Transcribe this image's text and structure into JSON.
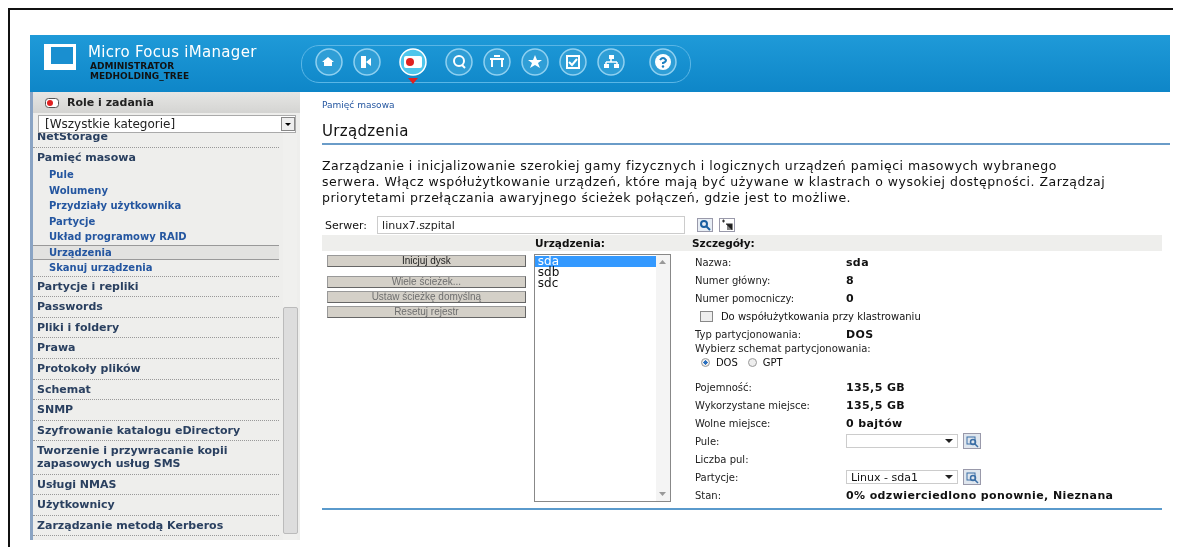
{
  "header": {
    "title": "Micro Focus iManager",
    "user": "ADMINISTRATOR",
    "tree": "MEDHOLDING_TREE",
    "toolbar": [
      {
        "kind": "home",
        "selected": false
      },
      {
        "kind": "exit",
        "selected": false
      },
      {
        "kind": "roles",
        "selected": true
      },
      {
        "kind": "view",
        "selected": false
      },
      {
        "kind": "desk",
        "selected": false
      },
      {
        "kind": "star",
        "selected": false
      },
      {
        "kind": "tasks",
        "selected": false
      },
      {
        "kind": "tree",
        "selected": false
      },
      {
        "kind": "help",
        "selected": false
      }
    ]
  },
  "sidebar": {
    "heading": "Role i zadania",
    "category": "[Wszystkie kategorie]",
    "items": [
      {
        "label": "NetStorage"
      },
      {
        "label": "Pamięć masowa",
        "children": [
          {
            "label": "Pule",
            "selected": false
          },
          {
            "label": "Wolumeny",
            "selected": false
          },
          {
            "label": "Przydziały użytkownika",
            "selected": false
          },
          {
            "label": "Partycje",
            "selected": false
          },
          {
            "label": "Układ programowy RAID",
            "selected": false
          },
          {
            "label": "Urządzenia",
            "selected": true
          },
          {
            "label": "Skanuj urządzenia",
            "selected": false
          }
        ]
      },
      {
        "label": "Partycje i repliki"
      },
      {
        "label": "Passwords"
      },
      {
        "label": "Pliki i foldery"
      },
      {
        "label": "Prawa"
      },
      {
        "label": "Protokoły plików"
      },
      {
        "label": "Schemat"
      },
      {
        "label": "SNMP"
      },
      {
        "label": "Szyfrowanie katalogu eDirectory"
      },
      {
        "label": "Tworzenie i przywracanie kopii zapasowych usług SMS"
      },
      {
        "label": "Usługi NMAS"
      },
      {
        "label": "Użytkownicy"
      },
      {
        "label": "Zarządzanie metodą Kerberos"
      }
    ]
  },
  "content": {
    "breadcrumb": "Pamięć masowa",
    "title": "Urządzenia",
    "description": "Zarządzanie i inicjalizowanie szerokiej gamy fizycznych i logicznych urządzeń pamięci masowych wybranego serwera. Włącz współużytkowanie urządzeń, które mają być używane w klastrach o wysokiej dostępności. Zarządzaj priorytetami przełączania awaryjnego ścieżek połączeń, gdzie jest to możliwe.",
    "server": {
      "label": "Serwer:",
      "value": "linux7.szpital"
    },
    "devices_header": "Urządzenia:",
    "details_header": "Szczegóły:",
    "buttons": [
      {
        "label": "Inicjuj dysk",
        "disabled": false
      },
      {
        "label": "Wiele ścieżek...",
        "disabled": true
      },
      {
        "label": "Ustaw ścieżkę domyślną",
        "disabled": true
      },
      {
        "label": "Resetuj rejestr",
        "disabled": true
      }
    ],
    "devices": [
      {
        "name": "sda",
        "selected": true
      },
      {
        "name": "sdb",
        "selected": false
      },
      {
        "name": "sdc",
        "selected": false
      }
    ],
    "details": [
      {
        "kind": "text",
        "label": "Nazwa:",
        "value": "sda"
      },
      {
        "kind": "text",
        "label": "Numer główny:",
        "value": "8"
      },
      {
        "kind": "text",
        "label": "Numer pomocniczy:",
        "value": "0"
      },
      {
        "kind": "checkbox",
        "label": "Do współużytkowania przy klastrowaniu",
        "checked": false
      },
      {
        "kind": "text",
        "label": "Typ partycjonowania:",
        "value": "DOS"
      },
      {
        "kind": "radio",
        "label": "Wybierz schemat partycjonowania:",
        "options": [
          {
            "label": "DOS",
            "selected": true
          },
          {
            "label": "GPT",
            "selected": false
          }
        ]
      },
      {
        "kind": "text",
        "label": "Pojemność:",
        "value": "135,5 GB"
      },
      {
        "kind": "text",
        "label": "Wykorzystane miejsce:",
        "value": "135,5 GB"
      },
      {
        "kind": "text",
        "label": "Wolne miejsce:",
        "value": "0 bajtów"
      },
      {
        "kind": "select",
        "label": "Pule:"
      },
      {
        "kind": "text",
        "label": "Liczba pul:"
      },
      {
        "kind": "select",
        "label": "Partycje:",
        "value": "Linux - sda1"
      },
      {
        "kind": "text",
        "label": "Stan:",
        "value": "0% odzwierciedlono ponownie, Nieznana"
      }
    ]
  }
}
